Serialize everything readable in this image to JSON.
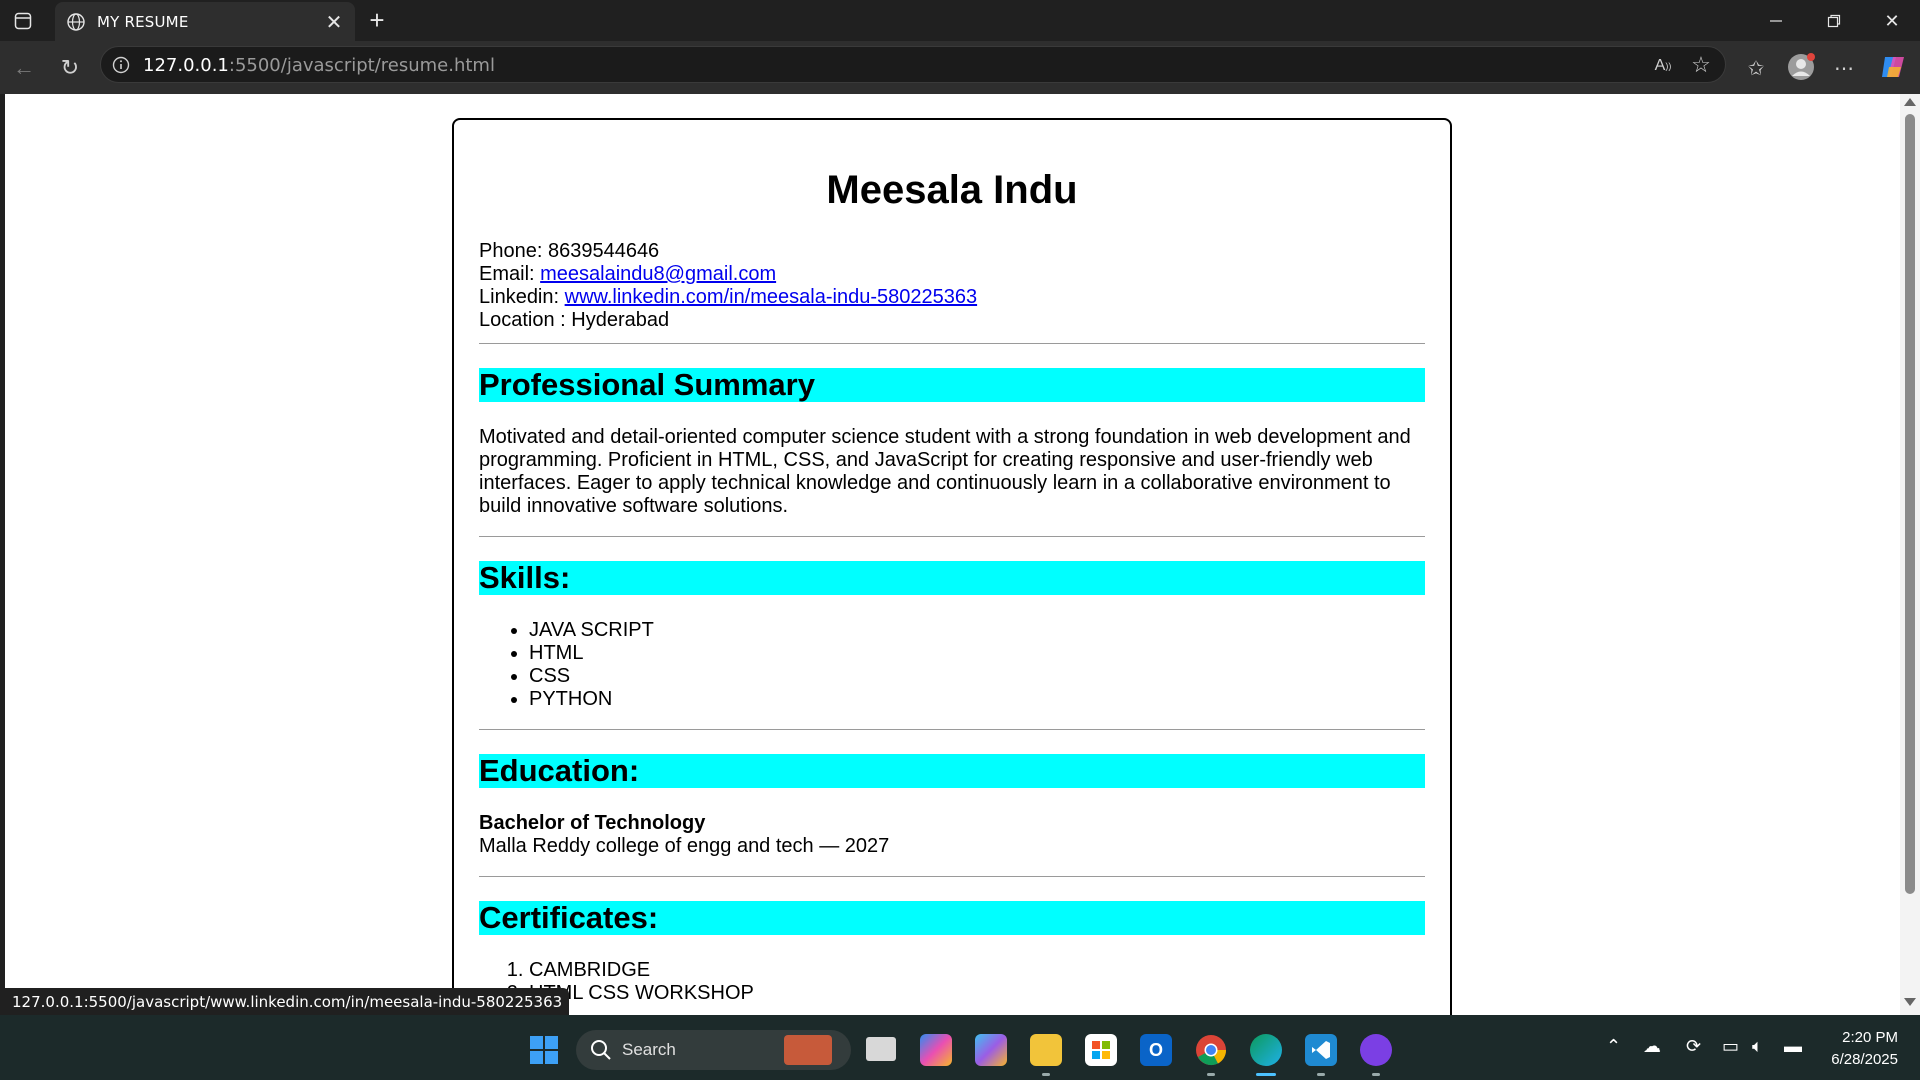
{
  "browser": {
    "tab_title": "MY RESUME",
    "url_host": "127.0.0.1",
    "url_rest": ":5500/javascript/resume.html",
    "status_link": "127.0.0.1:5500/javascript/www.linkedin.com/in/meesala-indu-580225363"
  },
  "resume": {
    "name": "Meesala Indu",
    "phone_label": "Phone:",
    "phone": "8639544646",
    "email_label": "Email:",
    "email": "meesalaindu8@gmail.com",
    "linkedin_label": "Linkedin:",
    "linkedin": "www.linkedin.com/in/meesala-indu-580225363",
    "location_label": "Location :",
    "location": "Hyderabad",
    "summary_heading": "Professional Summary",
    "summary_text": "Motivated and detail-oriented computer science student with a strong foundation in web development and programming. Proficient in HTML, CSS, and JavaScript for creating responsive and user-friendly web interfaces. Eager to apply technical knowledge and continuously learn in a collaborative environment to build innovative software solutions.",
    "skills_heading": "Skills:",
    "skills": [
      "JAVA SCRIPT",
      "HTML",
      "CSS",
      "PYTHON"
    ],
    "education_heading": "Education:",
    "degree": "Bachelor of Technology",
    "college": "Malla Reddy college of engg and tech — 2027",
    "certificates_heading": "Certificates:",
    "certificates": [
      "CAMBRIDGE",
      "HTML CSS WORKSHOP"
    ]
  },
  "taskbar": {
    "search_label": "Search",
    "time": "2:20 PM",
    "date": "6/28/2025"
  },
  "colors": {
    "section_heading_bg": "#00ffff",
    "link": "#0000ee"
  }
}
